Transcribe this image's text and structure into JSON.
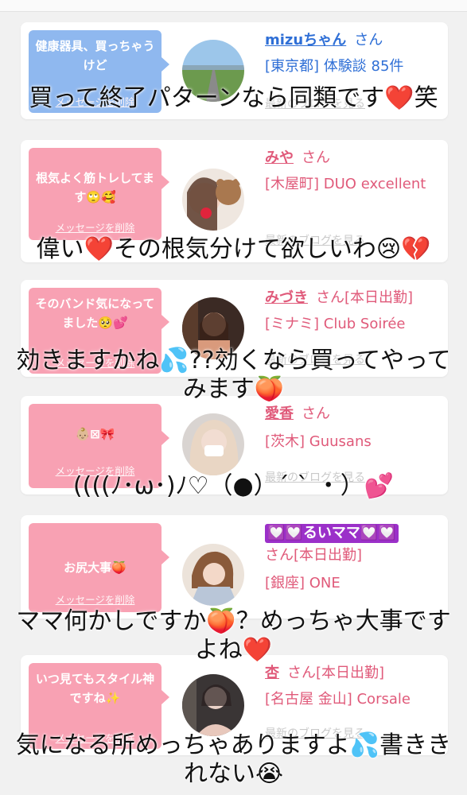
{
  "cards": [
    {
      "message": "健康器具、買っちゃうけど",
      "delete_label": "メッセージを削除",
      "name": "mizuちゃん",
      "suffix": "さん",
      "shop": "[東京都] 体験談 85件",
      "blog_label": "最新のブログを見る",
      "theme": "blue",
      "avatar": "road-landscape-photo"
    },
    {
      "message": "根気よく筋トレしてます🙄🥰",
      "delete_label": "メッセージを削除",
      "name": "みや",
      "suffix": "さん",
      "shop": "[木屋町] DUO excellent",
      "blog_label": "最新のブログを見る",
      "theme": "pink",
      "avatar": "woman-with-bear-photo"
    },
    {
      "message": "そのバンド気になってました🥺💕",
      "delete_label": "メッセージを削除",
      "name": "みづき",
      "suffix": "さん[本日出勤]",
      "shop": "[ミナミ] Club Soirée",
      "blog_label": "最新のブログを見る",
      "theme": "pink",
      "avatar": "woman-portrait-photo"
    },
    {
      "message": "👶🏼⊠🎀",
      "delete_label": "メッセージを削除",
      "name": "愛香",
      "suffix": "さん",
      "shop": "[茨木] Guusans",
      "blog_label": "最新のブログを見る",
      "theme": "pink",
      "avatar": "woman-mask-photo"
    },
    {
      "message": "お尻大事🍑",
      "delete_label": "メッセージを削除",
      "name": "💟💟るいママ💟💟",
      "suffix": "さん[本日出勤]",
      "shop": "[銀座] ONE",
      "blog_label": "",
      "theme": "pink",
      "avatar": "woman-kimono-photo"
    },
    {
      "message": "いつ見てもスタイル神ですね✨",
      "delete_label": "メッセージを削除",
      "name": "杏",
      "suffix": "さん[本日出勤]",
      "shop": "[名古屋 金山] Corsale",
      "blog_label": "最新のブログを見る",
      "theme": "pink",
      "avatar": "woman-selfie-photo"
    }
  ],
  "overlays": [
    "買って終了パターンなら同類です❤️笑",
    "偉い❤️その根気分けて欲しいわ😢💔",
    "効きますかね💦??効くなら買ってやってみます🍑",
    "((((ﾉ･ω･)ﾉ♡（●）´ ` ・）💕",
    "ママ何かしですか🍑？めっちゃ大事ですよね❤️",
    "気になる所めっちゃありますよ💦書ききれない😭"
  ],
  "colors": {
    "pink_bubble": "#f8a1b3",
    "blue_bubble": "#8fb8ef",
    "pink_text": "#e05a7a",
    "blue_text": "#2f6fd6",
    "background": "#f1f1f1"
  }
}
